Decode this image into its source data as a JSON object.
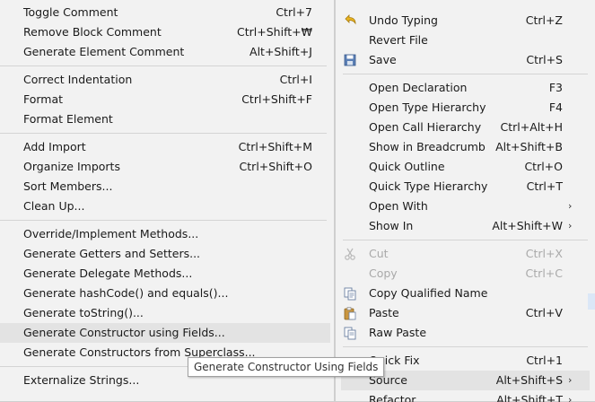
{
  "source_submenu": {
    "items": [
      {
        "label": "Toggle Comment",
        "accel": "Ctrl+7"
      },
      {
        "label": "Remove Block Comment",
        "accel": "Ctrl+Shift+₩"
      },
      {
        "label": "Generate Element Comment",
        "accel": "Alt+Shift+J"
      },
      {
        "label": "Correct Indentation",
        "accel": "Ctrl+I"
      },
      {
        "label": "Format",
        "accel": "Ctrl+Shift+F"
      },
      {
        "label": "Format Element",
        "accel": ""
      },
      {
        "label": "Add Import",
        "accel": "Ctrl+Shift+M"
      },
      {
        "label": "Organize Imports",
        "accel": "Ctrl+Shift+O"
      },
      {
        "label": "Sort Members...",
        "accel": ""
      },
      {
        "label": "Clean Up...",
        "accel": ""
      },
      {
        "label": "Override/Implement Methods...",
        "accel": ""
      },
      {
        "label": "Generate Getters and Setters...",
        "accel": ""
      },
      {
        "label": "Generate Delegate Methods...",
        "accel": ""
      },
      {
        "label": "Generate hashCode() and equals()...",
        "accel": ""
      },
      {
        "label": "Generate toString()...",
        "accel": ""
      },
      {
        "label": "Generate Constructor using Fields...",
        "accel": ""
      },
      {
        "label": "Generate Constructors from Superclass...",
        "accel": ""
      },
      {
        "label": "Externalize Strings...",
        "accel": ""
      }
    ]
  },
  "tooltip": {
    "text": "Generate Constructor Using Fields"
  },
  "context_menu": {
    "items": [
      {
        "label": "Undo Typing",
        "accel": "Ctrl+Z",
        "icon": "undo-icon"
      },
      {
        "label": "Revert File",
        "accel": ""
      },
      {
        "label": "Save",
        "accel": "Ctrl+S",
        "icon": "save-icon"
      },
      {
        "label": "Open Declaration",
        "accel": "F3"
      },
      {
        "label": "Open Type Hierarchy",
        "accel": "F4"
      },
      {
        "label": "Open Call Hierarchy",
        "accel": "Ctrl+Alt+H"
      },
      {
        "label": "Show in Breadcrumb",
        "accel": "Alt+Shift+B"
      },
      {
        "label": "Quick Outline",
        "accel": "Ctrl+O"
      },
      {
        "label": "Quick Type Hierarchy",
        "accel": "Ctrl+T"
      },
      {
        "label": "Open With",
        "accel": ""
      },
      {
        "label": "Show In",
        "accel": "Alt+Shift+W"
      },
      {
        "label": "Cut",
        "accel": "Ctrl+X",
        "icon": "cut-icon"
      },
      {
        "label": "Copy",
        "accel": "Ctrl+C",
        "icon": "copy-icon"
      },
      {
        "label": "Copy Qualified Name",
        "accel": "",
        "icon": "copy-qualified-name-icon"
      },
      {
        "label": "Paste",
        "accel": "Ctrl+V",
        "icon": "paste-icon"
      },
      {
        "label": "Raw Paste",
        "accel": "",
        "icon": "raw-paste-icon"
      },
      {
        "label": "Quick Fix",
        "accel": "Ctrl+1"
      },
      {
        "label": "Source",
        "accel": "Alt+Shift+S"
      },
      {
        "label": "Refactor",
        "accel": "Alt+Shift+T"
      }
    ]
  },
  "colors": {
    "menu_bg": "#f2f2f2",
    "highlight": "#e3e3e3",
    "disabled_text": "#a9a9a9",
    "separator": "#d4d4d4"
  }
}
